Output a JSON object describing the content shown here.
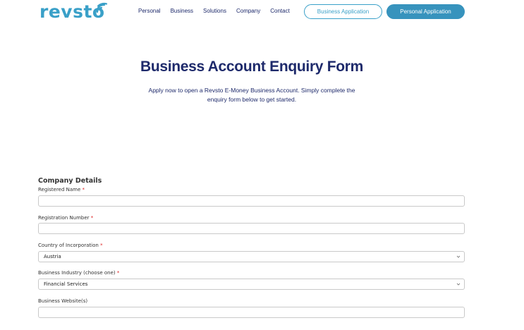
{
  "brand": {
    "logo_text": "revsto",
    "accent": "#3aa0c8",
    "dark": "#1e2a6b"
  },
  "nav": {
    "items": [
      {
        "label": "Personal"
      },
      {
        "label": "Business"
      },
      {
        "label": "Solutions"
      },
      {
        "label": "Company"
      },
      {
        "label": "Contact"
      }
    ],
    "business_application": "Business Application",
    "personal_application": "Personal Application"
  },
  "hero": {
    "title": "Business Account Enquiry Form",
    "subtitle": "Apply now to open a Revsto E-Money Business Account. Simply complete the enquiry form below to get started."
  },
  "form": {
    "section_title": "Company Details",
    "required_mark": "*",
    "fields": {
      "registered_name": {
        "label": "Registered Name",
        "value": ""
      },
      "registration_number": {
        "label": "Registration Number",
        "value": ""
      },
      "country": {
        "label": "Country of Incorporation",
        "value": "Austria"
      },
      "industry": {
        "label": "Business Industry (choose one)",
        "value": "Financial Services"
      },
      "website": {
        "label": "Business Website(s)",
        "value": ""
      }
    }
  }
}
